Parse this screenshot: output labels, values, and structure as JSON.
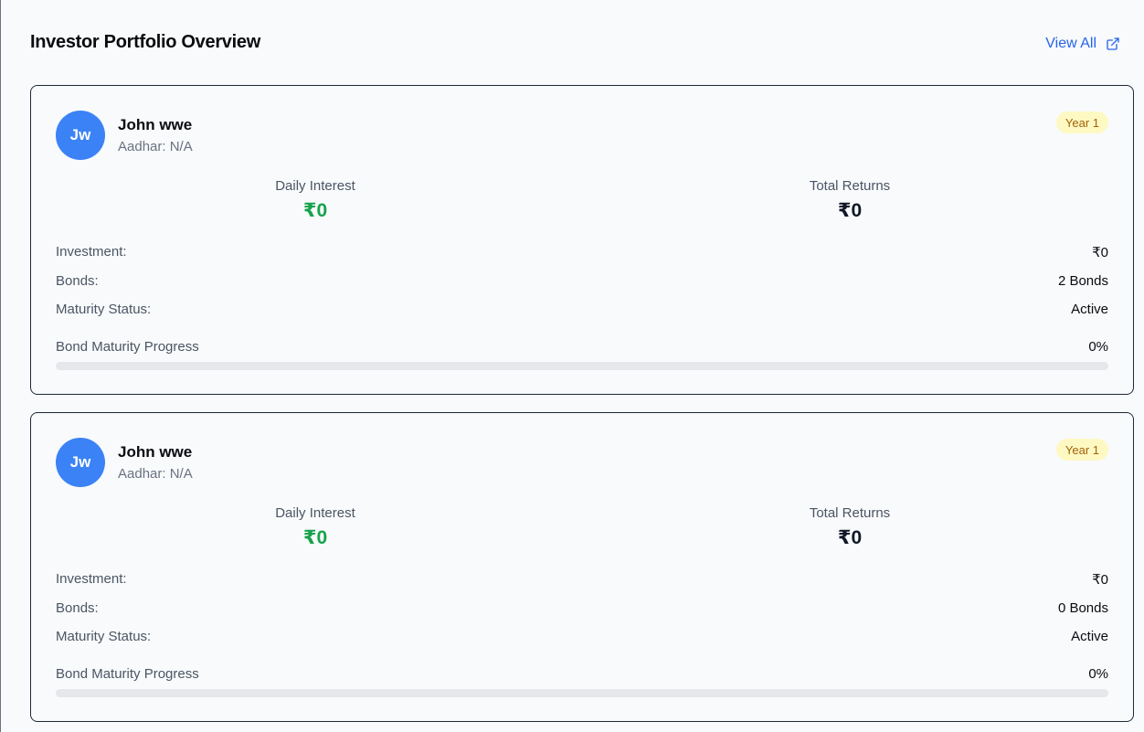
{
  "header": {
    "title": "Investor Portfolio Overview",
    "view_all_label": "View All",
    "view_all_icon": "external-link-icon"
  },
  "colors": {
    "accent": "#2563eb",
    "avatar_bg": "#3b82f6",
    "positive": "#16a34a",
    "badge_bg": "#fef9c3",
    "badge_text": "#a16207"
  },
  "investors": [
    {
      "initials": "Jw",
      "name": "John wwe",
      "aadhar": "Aadhar: N/A",
      "badge": "Year 1",
      "daily_interest_label": "Daily Interest",
      "daily_interest_value": "₹0",
      "total_returns_label": "Total Returns",
      "total_returns_value": "₹0",
      "investment_label": "Investment:",
      "investment_value": "₹0",
      "bonds_label": "Bonds:",
      "bonds_value": "2 Bonds",
      "maturity_label": "Maturity Status:",
      "maturity_value": "Active",
      "progress_label": "Bond Maturity Progress",
      "progress_text": "0%",
      "progress_percent": 0
    },
    {
      "initials": "Jw",
      "name": "John wwe",
      "aadhar": "Aadhar: N/A",
      "badge": "Year 1",
      "daily_interest_label": "Daily Interest",
      "daily_interest_value": "₹0",
      "total_returns_label": "Total Returns",
      "total_returns_value": "₹0",
      "investment_label": "Investment:",
      "investment_value": "₹0",
      "bonds_label": "Bonds:",
      "bonds_value": "0 Bonds",
      "maturity_label": "Maturity Status:",
      "maturity_value": "Active",
      "progress_label": "Bond Maturity Progress",
      "progress_text": "0%",
      "progress_percent": 0
    }
  ]
}
